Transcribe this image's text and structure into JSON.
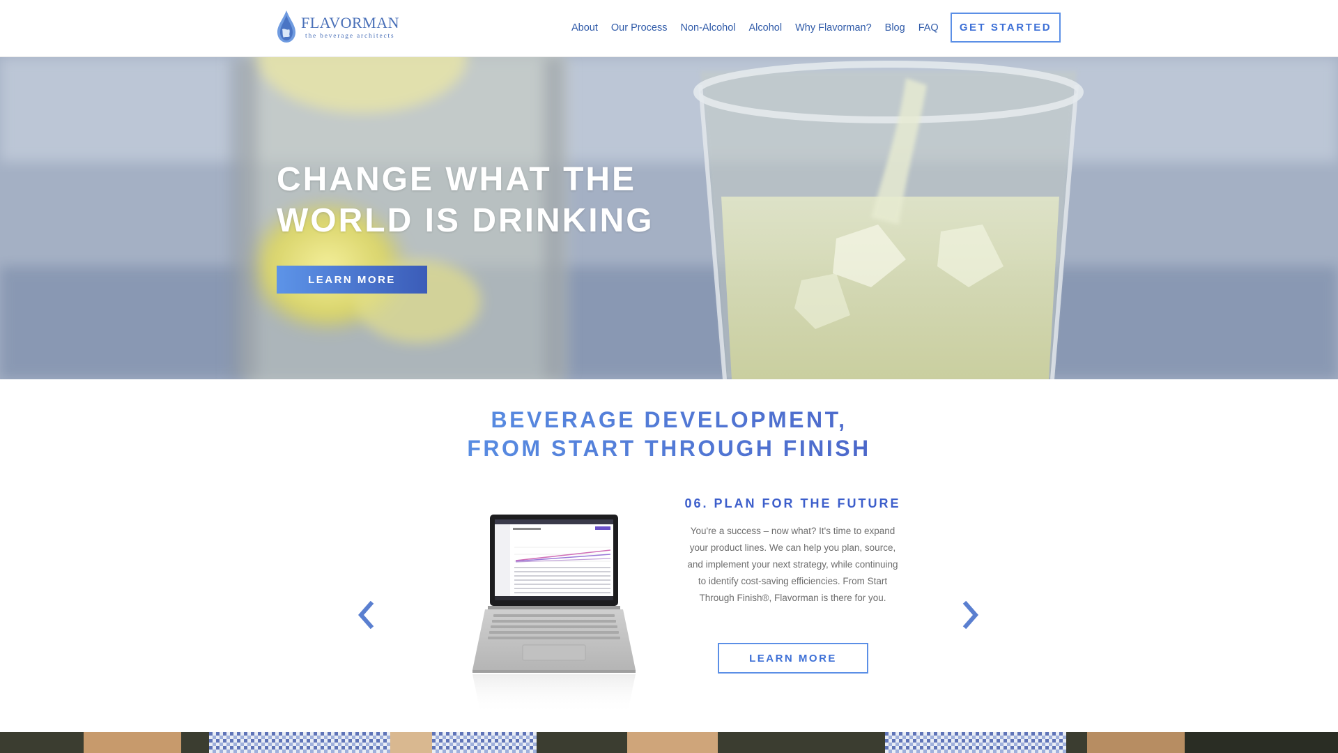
{
  "header": {
    "logo": {
      "name": "FLAVORMAN",
      "tagline": "the beverage architects"
    },
    "nav": [
      {
        "label": "About"
      },
      {
        "label": "Our Process"
      },
      {
        "label": "Non-Alcohol"
      },
      {
        "label": "Alcohol"
      },
      {
        "label": "Why Flavorman?"
      },
      {
        "label": "Blog"
      },
      {
        "label": "FAQ"
      }
    ],
    "cta_label": "GET STARTED"
  },
  "hero": {
    "title_line1": "CHANGE WHAT THE",
    "title_line2": "WORLD IS DRINKING",
    "button_label": "LEARN MORE"
  },
  "section": {
    "title_line1": "BEVERAGE DEVELOPMENT,",
    "title_line2": "FROM START THROUGH FINISH",
    "step": {
      "title": "06. PLAN FOR THE FUTURE",
      "description": "You're a success – now what? It's time to expand your product lines. We can help you plan, source, and implement your next strategy, while continuing to identify cost-saving efficiencies. From Start Through Finish®, Flavorman is there for you.",
      "button_label": "LEARN MORE"
    },
    "carousel": {
      "prev_icon": "chevron-left-icon",
      "next_icon": "chevron-right-icon"
    }
  },
  "colors": {
    "brand_blue": "#3c6fd6",
    "nav_blue": "#2f5aa8",
    "accent_light": "#5b8fe6",
    "text_gray": "#6d6d6d"
  }
}
